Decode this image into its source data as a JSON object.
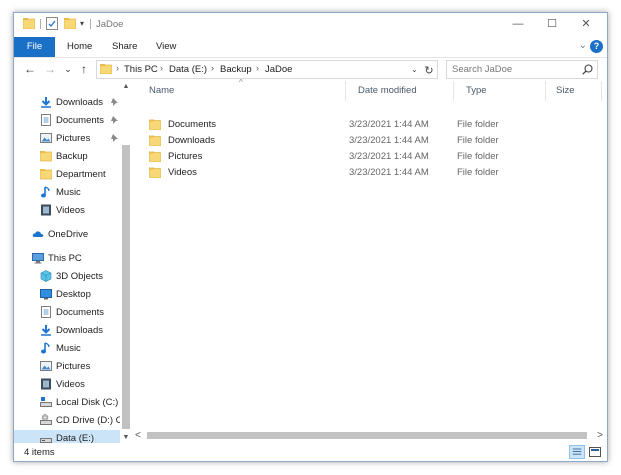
{
  "window": {
    "title": "JaDoe"
  },
  "title_buttons": {
    "minimize": "—",
    "maximize": "☐",
    "close": "✕"
  },
  "ribbon": {
    "tabs": [
      "File",
      "Home",
      "Share",
      "View"
    ],
    "expand": "⌄",
    "help": "?"
  },
  "nav_buttons": {
    "back": "←",
    "forward": "→",
    "recent": "⌄",
    "up": "↑"
  },
  "address": {
    "crumbs": [
      "This PC",
      "Data (E:)",
      "Backup",
      "JaDoe"
    ],
    "separator": "›",
    "dropdown": "⌄",
    "refresh": "↻"
  },
  "search": {
    "placeholder": "Search JaDoe"
  },
  "nav_pane": {
    "quick_access": [
      {
        "label": "Downloads",
        "icon": "download-icon",
        "pinned": true
      },
      {
        "label": "Documents",
        "icon": "document-icon",
        "pinned": true
      },
      {
        "label": "Pictures",
        "icon": "pictures-icon",
        "pinned": true
      },
      {
        "label": "Backup",
        "icon": "folder-icon",
        "pinned": false
      },
      {
        "label": "Department",
        "icon": "folder-icon",
        "pinned": false
      },
      {
        "label": "Music",
        "icon": "music-icon",
        "pinned": false
      },
      {
        "label": "Videos",
        "icon": "videos-icon",
        "pinned": false
      }
    ],
    "onedrive": "OneDrive",
    "this_pc": "This PC",
    "this_pc_items": [
      {
        "label": "3D Objects",
        "icon": "3d-objects-icon"
      },
      {
        "label": "Desktop",
        "icon": "desktop-icon"
      },
      {
        "label": "Documents",
        "icon": "document-icon"
      },
      {
        "label": "Downloads",
        "icon": "download-icon"
      },
      {
        "label": "Music",
        "icon": "music-icon"
      },
      {
        "label": "Pictures",
        "icon": "pictures-icon"
      },
      {
        "label": "Videos",
        "icon": "videos-icon"
      },
      {
        "label": "Local Disk (C:)",
        "icon": "local-disk-icon"
      },
      {
        "label": "CD Drive (D:) CP",
        "icon": "cd-drive-icon"
      },
      {
        "label": "Data (E:)",
        "icon": "drive-icon",
        "selected": true
      }
    ]
  },
  "columns": {
    "name": "Name",
    "date": "Date modified",
    "type": "Type",
    "size": "Size"
  },
  "files": [
    {
      "name": "Documents",
      "date": "3/23/2021 1:44 AM",
      "type": "File folder"
    },
    {
      "name": "Downloads",
      "date": "3/23/2021 1:44 AM",
      "type": "File folder"
    },
    {
      "name": "Pictures",
      "date": "3/23/2021 1:44 AM",
      "type": "File folder"
    },
    {
      "name": "Videos",
      "date": "3/23/2021 1:44 AM",
      "type": "File folder"
    }
  ],
  "status": {
    "item_count": "4 items"
  },
  "colors": {
    "accent": "#1a6fc7",
    "folder": "#f8d775",
    "selection": "#cce4f7"
  }
}
